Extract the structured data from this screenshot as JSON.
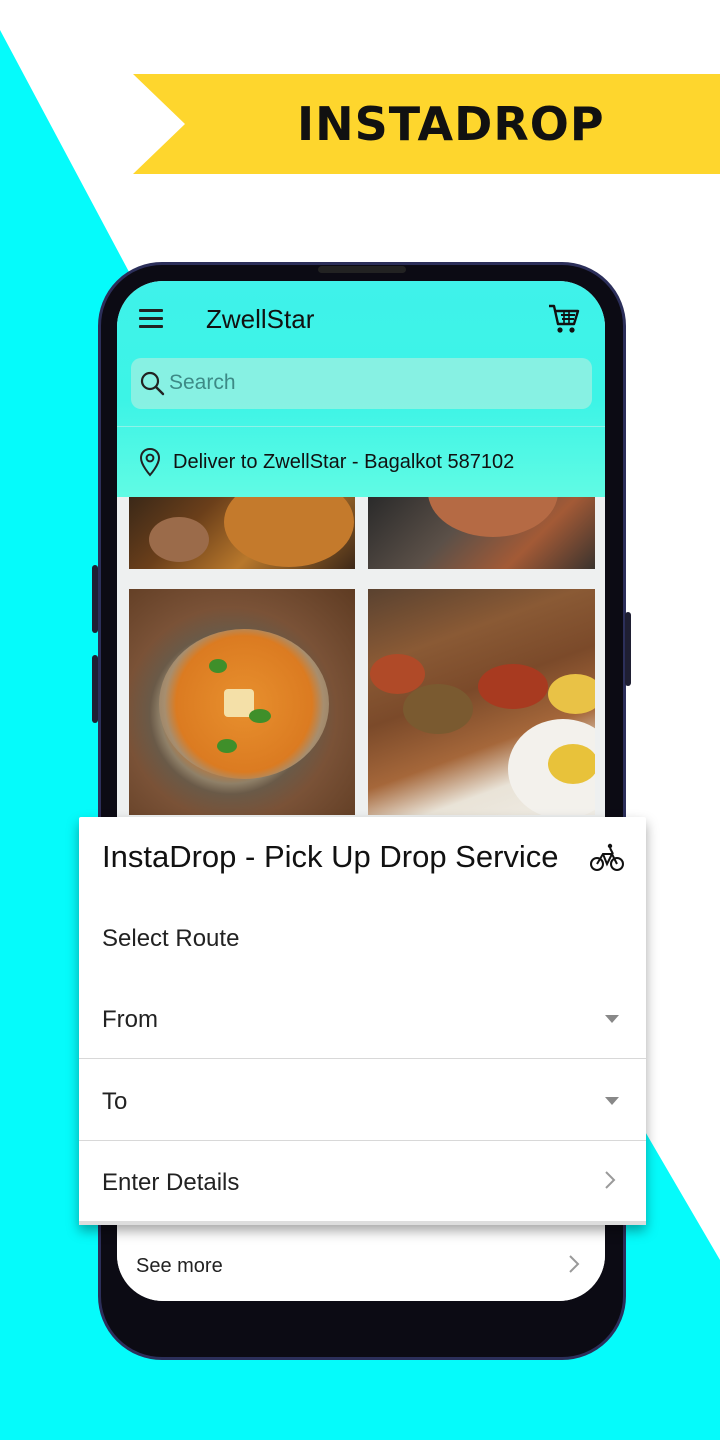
{
  "banner": {
    "title": "INSTADROP"
  },
  "app": {
    "title": "ZwellStar",
    "search_placeholder": "Search",
    "deliver_to": "Deliver to ZwellStar - Bagalkot 587102",
    "see_more": "See more"
  },
  "card": {
    "title": "InstaDrop - Pick Up Drop Service",
    "select_route": "Select Route",
    "from_label": "From",
    "to_label": "To",
    "details_label": "Enter Details"
  },
  "colors": {
    "background_accent": "#05fbfb",
    "banner": "#fed62d",
    "header": "#3ff2ea"
  },
  "icons": [
    "menu-icon",
    "cart-icon",
    "search-icon",
    "location-pin-icon",
    "bicycle-icon",
    "chevron-right-icon",
    "dropdown-arrow-icon"
  ]
}
